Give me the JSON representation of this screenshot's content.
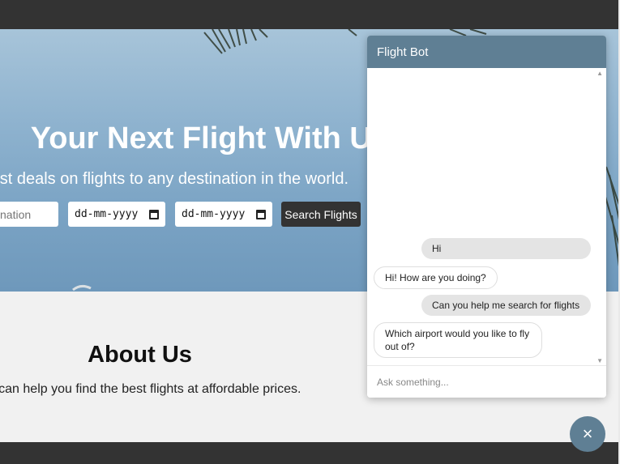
{
  "hero": {
    "title": "Your Next Flight With Us",
    "subtitle": "best deals on flights to any destination in the world.",
    "destination_placeholder": "nation",
    "date1": "dd-mm-yyyy",
    "date2": "dd-mm-yyyy",
    "search_label": "Search Flights"
  },
  "about": {
    "title": "About Us",
    "text": "We can help you find the best flights at affordable prices."
  },
  "chatbot": {
    "title": "Flight Bot",
    "messages": [
      {
        "from": "user",
        "text": "Hi"
      },
      {
        "from": "bot",
        "text": "Hi! How are you doing?"
      },
      {
        "from": "user",
        "text": "Can you help me search for flights"
      },
      {
        "from": "bot",
        "text": "Which airport would you like to fly out of?"
      }
    ],
    "input_placeholder": "Ask something...",
    "close_icon": "×"
  },
  "colors": {
    "topbar": "#333333",
    "chat_accent": "#5f7f94",
    "button": "#333333"
  }
}
